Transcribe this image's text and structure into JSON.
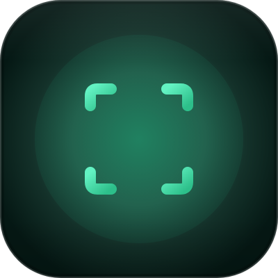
{
  "icon": {
    "name": "document-scan-icon",
    "colors": {
      "background": "#06221b",
      "glow": "#1b7f61",
      "glyph": "#41d3a0",
      "glyph_light": "#5ff0bf"
    }
  }
}
